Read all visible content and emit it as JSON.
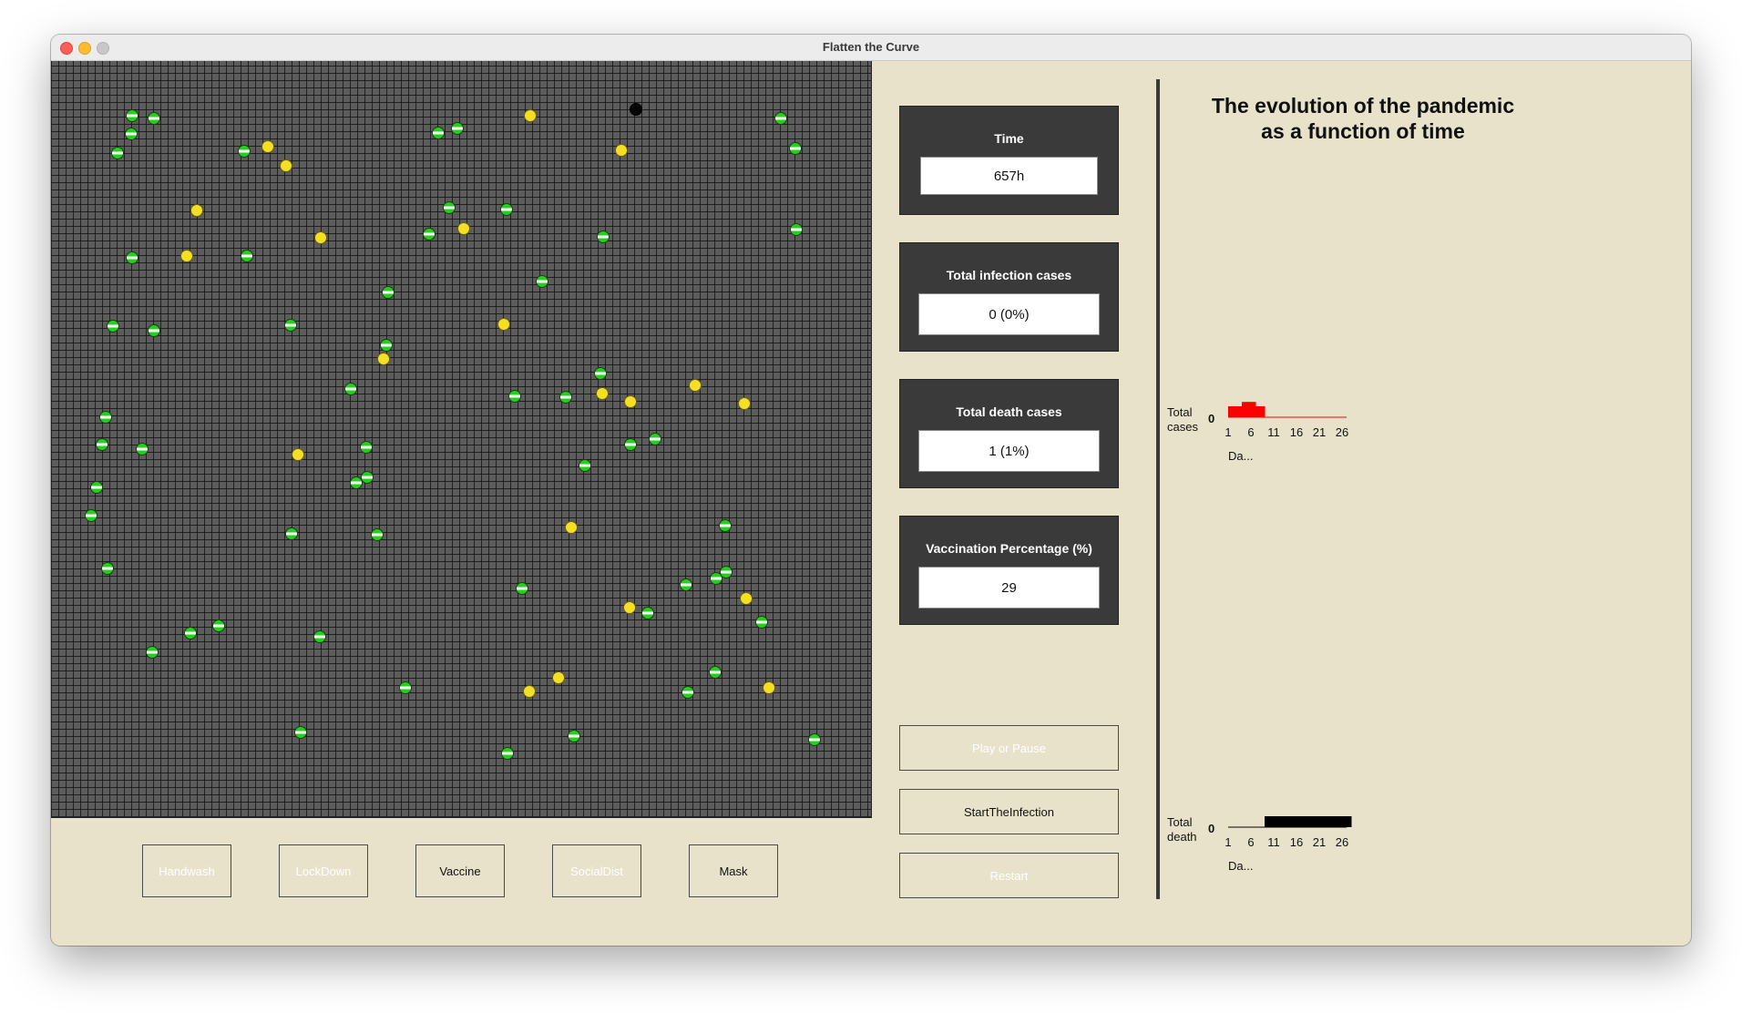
{
  "window": {
    "title": "Flatten the Curve"
  },
  "stats": {
    "time": {
      "label": "Time",
      "value": "657h"
    },
    "infections": {
      "label": "Total infection cases",
      "value": "0 (0%)"
    },
    "deaths": {
      "label": "Total death cases",
      "value": "1 (1%)"
    },
    "vaccination": {
      "label": "Vaccination Percentage (%)",
      "value": "29"
    }
  },
  "controls": {
    "handwash": "Handwash",
    "lockdown": "LockDown",
    "vaccine": "Vaccine",
    "socialdist": "SocialDist",
    "mask": "Mask"
  },
  "actions": {
    "play_pause": "Play or Pause",
    "start_infection": "StartTheInfection",
    "restart": "Restart"
  },
  "chart_title_line1": "The evolution of the pandemic",
  "chart_title_line2": "as a function of time",
  "colors": {
    "healthy": "#22d11a",
    "recovered": "#f3e024",
    "dead": "#050505",
    "cases_series": "#ff0000",
    "death_series": "#000000"
  },
  "chart_data": [
    {
      "type": "area",
      "ylabel_line1": "Total",
      "ylabel_line2": "cases",
      "ytick": "0",
      "xlabel": "Da...",
      "x_ticks": [
        "1",
        "6",
        "11",
        "16",
        "21",
        "26"
      ],
      "series": [
        {
          "values": [
            1,
            1,
            1,
            1.4,
            1.4,
            1.4,
            1,
            1,
            0,
            0,
            0,
            0,
            0,
            0,
            0,
            0,
            0,
            0,
            0,
            0,
            0,
            0,
            0,
            0,
            0,
            0,
            0
          ]
        }
      ],
      "xlim": [
        1,
        27
      ],
      "ylim": [
        0,
        2
      ]
    },
    {
      "type": "area",
      "ylabel_line1": "Total",
      "ylabel_line2": "death",
      "ytick": "0",
      "xlabel": "Da...",
      "x_ticks": [
        "1",
        "6",
        "11",
        "16",
        "21",
        "26"
      ],
      "series": [
        {
          "values": [
            0,
            0,
            0,
            0,
            0,
            0,
            0,
            0,
            1,
            1,
            1,
            1,
            1,
            1,
            1,
            1,
            1,
            1,
            1,
            1,
            1,
            1,
            1,
            1,
            1,
            1,
            1
          ]
        }
      ],
      "xlim": [
        1,
        27
      ],
      "ylim": [
        0,
        2
      ]
    }
  ]
}
